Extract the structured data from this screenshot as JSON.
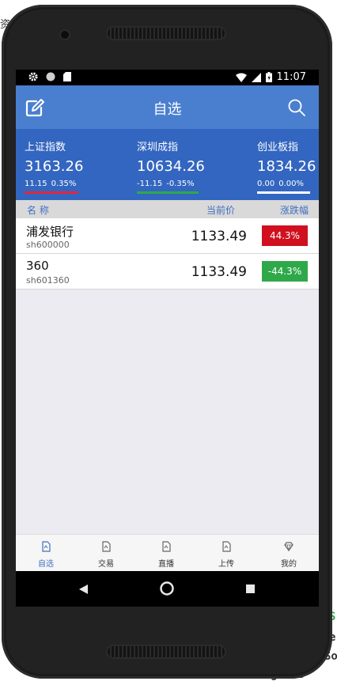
{
  "app": {
    "title": "自选"
  },
  "status_bar": {
    "time": "11:07"
  },
  "indices": [
    {
      "name": "上证指数",
      "value": "3163.26",
      "change": "11.15",
      "percent": "0.35%",
      "color": "#e0283c"
    },
    {
      "name": "深圳成指",
      "value": "10634.26",
      "change": "-11.15",
      "percent": "-0.35%",
      "color": "#2fa84a"
    },
    {
      "name": "创业板指",
      "value": "1834.26",
      "change": "0.00",
      "percent": "0.00%",
      "color": "#ffffff"
    }
  ],
  "columns": {
    "name": "名 称",
    "price": "当前价",
    "change": "涨跌幅"
  },
  "stocks": [
    {
      "name": "浦发银行",
      "code": "sh600000",
      "price": "1133.49",
      "change": "44.3%",
      "color": "#d0101e"
    },
    {
      "name": "360",
      "code": "sh601360",
      "price": "1133.49",
      "change": "-44.3%",
      "color": "#2fa84a"
    }
  ],
  "tabs": [
    {
      "label": "自选",
      "icon": "watchlist-icon"
    },
    {
      "label": "交易",
      "icon": "trade-icon"
    },
    {
      "label": "直播",
      "icon": "live-icon"
    },
    {
      "label": "上传",
      "icon": "upload-icon"
    },
    {
      "label": "我的",
      "icon": "profile-icon"
    }
  ],
  "accent_color": "#4a7fd0",
  "side_text": [
    "资",
    "S",
    "e",
    "So",
    "Starting the"
  ]
}
